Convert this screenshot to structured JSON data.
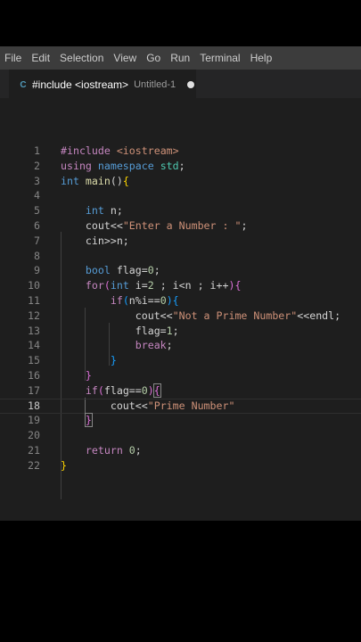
{
  "menu": {
    "items": [
      "File",
      "Edit",
      "Selection",
      "View",
      "Go",
      "Run",
      "Terminal",
      "Help"
    ]
  },
  "tab": {
    "icon_label": "C",
    "title": "#include <iostream>",
    "description": "Untitled-1"
  },
  "editor": {
    "current_line": 18,
    "lines": [
      {
        "n": "1",
        "tokens": [
          [
            "pre",
            "#include "
          ],
          [
            "str",
            "<iostream>"
          ]
        ]
      },
      {
        "n": "2",
        "tokens": [
          [
            "ctrl",
            "using "
          ],
          [
            "type",
            "namespace "
          ],
          [
            "ns",
            "std"
          ],
          [
            "plain",
            ";"
          ]
        ]
      },
      {
        "n": "3",
        "tokens": [
          [
            "type",
            "int "
          ],
          [
            "fn",
            "main"
          ],
          [
            "plain",
            "()"
          ],
          [
            "brace1",
            "{"
          ]
        ]
      },
      {
        "n": "4",
        "tokens": []
      },
      {
        "n": "5",
        "tokens": [
          [
            "plain",
            "    "
          ],
          [
            "type",
            "int "
          ],
          [
            "plain",
            "n;"
          ]
        ]
      },
      {
        "n": "6",
        "tokens": [
          [
            "plain",
            "    cout<<"
          ],
          [
            "str",
            "\"Enter a Number : \""
          ],
          [
            "plain",
            ";"
          ]
        ]
      },
      {
        "n": "7",
        "tokens": [
          [
            "plain",
            "    cin>>n;"
          ]
        ]
      },
      {
        "n": "8",
        "tokens": []
      },
      {
        "n": "9",
        "tokens": [
          [
            "plain",
            "    "
          ],
          [
            "type",
            "bool "
          ],
          [
            "plain",
            "flag="
          ],
          [
            "num",
            "0"
          ],
          [
            "plain",
            ";"
          ]
        ]
      },
      {
        "n": "10",
        "tokens": [
          [
            "plain",
            "    "
          ],
          [
            "ctrl",
            "for"
          ],
          [
            "brace2",
            "("
          ],
          [
            "type",
            "int "
          ],
          [
            "plain",
            "i="
          ],
          [
            "num",
            "2"
          ],
          [
            "plain",
            " ; i<n ; i++"
          ],
          [
            "brace2",
            ")"
          ],
          [
            "brace2",
            "{"
          ]
        ]
      },
      {
        "n": "11",
        "tokens": [
          [
            "plain",
            "        "
          ],
          [
            "ctrl",
            "if"
          ],
          [
            "brace3",
            "("
          ],
          [
            "plain",
            "n%i=="
          ],
          [
            "num",
            "0"
          ],
          [
            "brace3",
            ")"
          ],
          [
            "brace3",
            "{"
          ]
        ]
      },
      {
        "n": "12",
        "tokens": [
          [
            "plain",
            "            cout<<"
          ],
          [
            "str",
            "\"Not a Prime Number\""
          ],
          [
            "plain",
            "<<endl;"
          ]
        ]
      },
      {
        "n": "13",
        "tokens": [
          [
            "plain",
            "            flag="
          ],
          [
            "num",
            "1"
          ],
          [
            "plain",
            ";"
          ]
        ]
      },
      {
        "n": "14",
        "tokens": [
          [
            "plain",
            "            "
          ],
          [
            "ctrl",
            "break"
          ],
          [
            "plain",
            ";"
          ]
        ]
      },
      {
        "n": "15",
        "tokens": [
          [
            "plain",
            "        "
          ],
          [
            "brace3",
            "}"
          ]
        ]
      },
      {
        "n": "16",
        "tokens": [
          [
            "plain",
            "    "
          ],
          [
            "brace2",
            "}"
          ]
        ]
      },
      {
        "n": "17",
        "tokens": [
          [
            "plain",
            "    "
          ],
          [
            "ctrl",
            "if"
          ],
          [
            "brace2",
            "("
          ],
          [
            "plain",
            "flag=="
          ],
          [
            "num",
            "0"
          ],
          [
            "brace2",
            ")"
          ],
          [
            "brace2m",
            "{"
          ]
        ]
      },
      {
        "n": "18",
        "tokens": [
          [
            "plain",
            "        cout<<"
          ],
          [
            "str",
            "\"Prime Number\""
          ]
        ]
      },
      {
        "n": "19",
        "tokens": [
          [
            "plain",
            "    "
          ],
          [
            "brace2m",
            "}"
          ]
        ]
      },
      {
        "n": "20",
        "tokens": []
      },
      {
        "n": "21",
        "tokens": [
          [
            "plain",
            "    "
          ],
          [
            "ctrl",
            "return "
          ],
          [
            "num",
            "0"
          ],
          [
            "plain",
            ";"
          ]
        ]
      },
      {
        "n": "22",
        "tokens": [
          [
            "brace1",
            "}"
          ]
        ]
      }
    ]
  }
}
